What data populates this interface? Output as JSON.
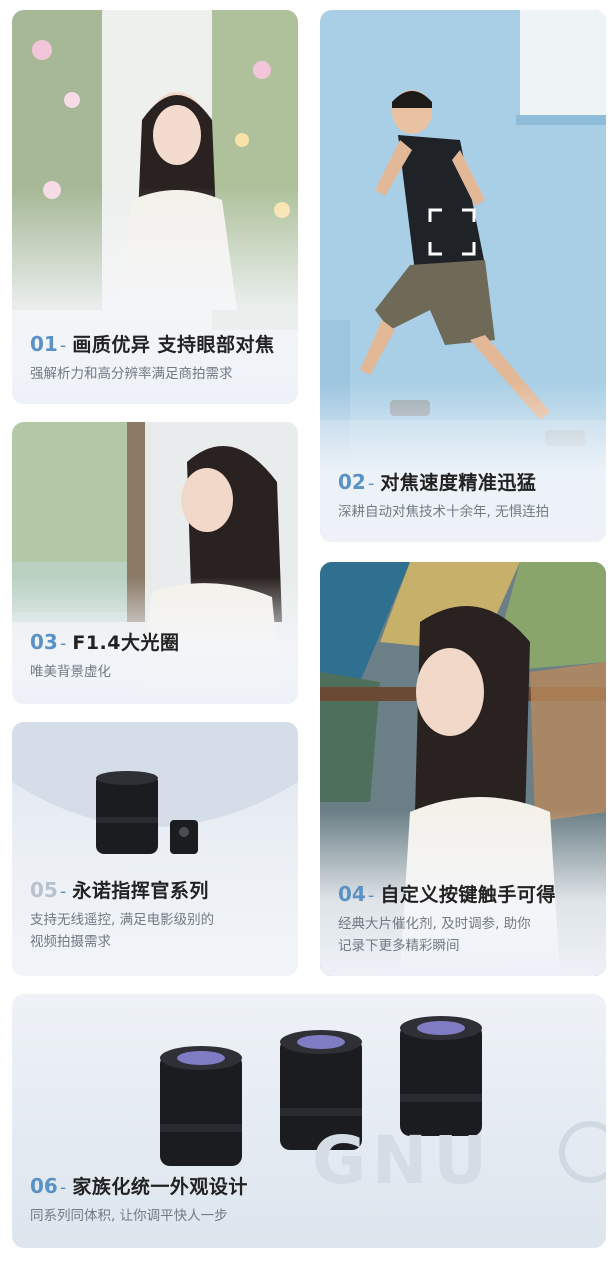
{
  "features": [
    {
      "num": "01",
      "dash": "-",
      "title": "画质优异 支持眼部对焦",
      "desc": "强解析力和高分辨率满足商拍需求"
    },
    {
      "num": "02",
      "dash": "-",
      "title": "对焦速度精准迅猛",
      "desc": "深耕自动对焦技术十余年, 无惧连拍"
    },
    {
      "num": "03",
      "dash": "-",
      "title": "F1.4大光圈",
      "desc": "唯美背景虚化"
    },
    {
      "num": "04",
      "dash": "-",
      "title": "自定义按键触手可得",
      "desc_line1": "经典大片催化剂, 及时调参, 助你",
      "desc_line2": "记录下更多精彩瞬间"
    },
    {
      "num": "05",
      "dash": "-",
      "title": "永诺指挥官系列",
      "desc_line1": "支持无线遥控, 满足电影级别的",
      "desc_line2": "视频拍摄需求"
    },
    {
      "num": "06",
      "dash": "-",
      "title": "家族化统一外观设计",
      "desc": "同系列同体积, 让你调平快人一步"
    }
  ],
  "product": {
    "lens_brand": "Yongnuo",
    "watermark": "GNU"
  },
  "colors": {
    "accent": "#5b92c6",
    "muted_num": "#b8c2cd",
    "title": "#222222",
    "desc": "#727a84",
    "sky": "#a9cfe6"
  }
}
